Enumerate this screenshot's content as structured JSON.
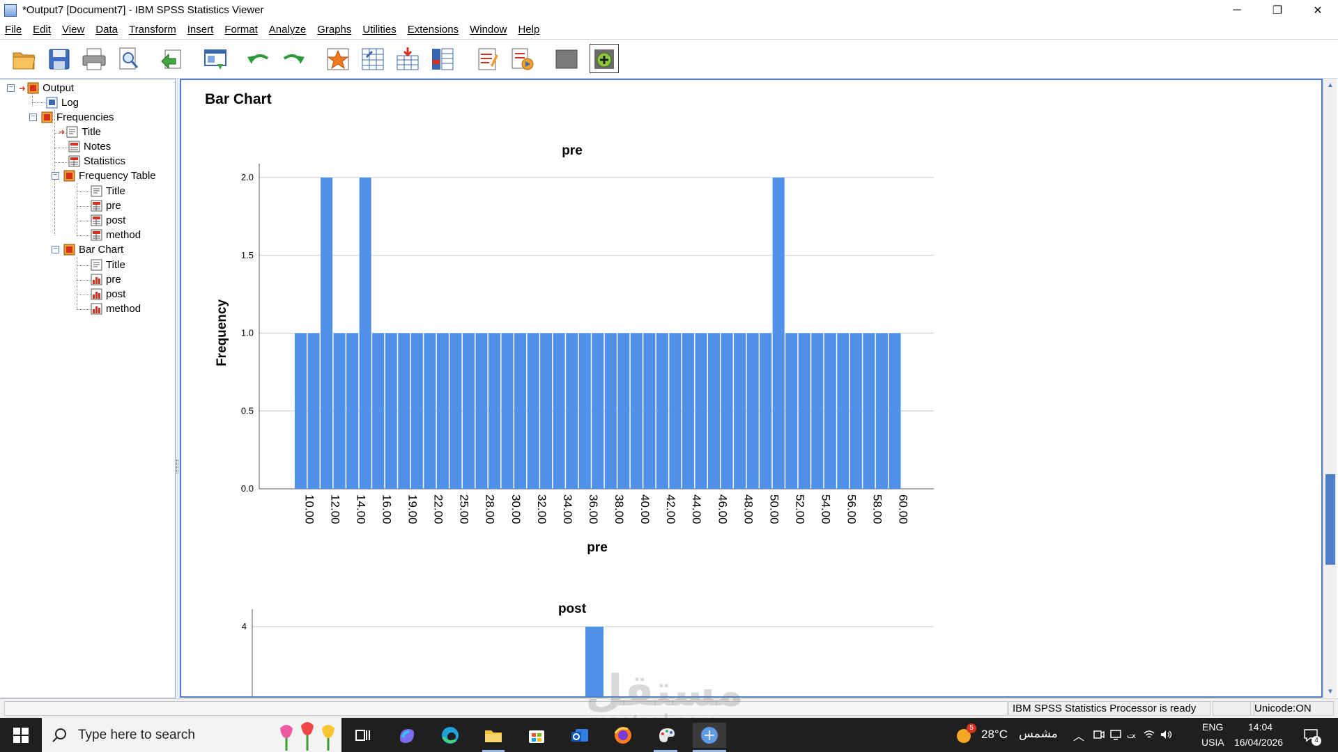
{
  "window": {
    "title": "*Output7 [Document7] - IBM SPSS Statistics Viewer",
    "minimize_glyph": "─",
    "restore_glyph": "❐",
    "close_glyph": "✕"
  },
  "menu": [
    "File",
    "Edit",
    "View",
    "Data",
    "Transform",
    "Insert",
    "Format",
    "Analyze",
    "Graphs",
    "Utilities",
    "Extensions",
    "Window",
    "Help"
  ],
  "toolbar": {
    "icons": [
      "open-folder-icon",
      "save-icon",
      "print-icon",
      "print-preview-icon",
      "export-icon",
      "recall-dialog-icon",
      "undo-icon",
      "redo-icon",
      "goto-data-icon",
      "goto-case-icon",
      "goto-variable-icon",
      "variables-icon",
      "designate-window-icon",
      "create-script-icon",
      "blank-icon",
      "add-icon"
    ]
  },
  "outline": {
    "root": "Output",
    "log": "Log",
    "frequencies": "Frequencies",
    "freq_title": "Title",
    "notes": "Notes",
    "statistics": "Statistics",
    "frequency_table": "Frequency Table",
    "ft_title": "Title",
    "ft_pre": "pre",
    "ft_post": "post",
    "ft_method": "method",
    "bar_chart": "Bar Chart",
    "bc_title": "Title",
    "bc_pre": "pre",
    "bc_post": "post",
    "bc_method": "method"
  },
  "content": {
    "section_heading": "Bar Chart"
  },
  "chart_data": [
    {
      "type": "bar",
      "title": "pre",
      "xlabel": "pre",
      "ylabel": "Frequency",
      "ylim": [
        0,
        2.0
      ],
      "yticks": [
        "0.0",
        "0.5",
        "1.0",
        "1.5",
        "2.0"
      ],
      "grid": true,
      "categories": [
        "10.00",
        "11.00",
        "12.00",
        "13.00",
        "14.00",
        "15.00",
        "16.00",
        "17.00",
        "19.00",
        "20.00",
        "22.00",
        "23.00",
        "25.00",
        "26.00",
        "28.00",
        "29.00",
        "30.00",
        "31.00",
        "32.00",
        "33.00",
        "34.00",
        "35.00",
        "36.00",
        "37.00",
        "38.00",
        "39.00",
        "40.00",
        "41.00",
        "42.00",
        "43.00",
        "44.00",
        "45.00",
        "46.00",
        "47.00",
        "48.00",
        "49.00",
        "50.00",
        "51.00",
        "52.00",
        "53.00",
        "54.00",
        "55.00",
        "56.00",
        "57.00",
        "58.00",
        "59.00",
        "60.00"
      ],
      "xtick_labels_shown": [
        "10.00",
        "12.00",
        "14.00",
        "16.00",
        "19.00",
        "22.00",
        "25.00",
        "28.00",
        "30.00",
        "32.00",
        "34.00",
        "36.00",
        "38.00",
        "40.00",
        "42.00",
        "44.00",
        "46.00",
        "48.00",
        "50.00",
        "52.00",
        "54.00",
        "56.00",
        "58.00",
        "60.00"
      ],
      "values": [
        1,
        1,
        2,
        1,
        1,
        2,
        1,
        1,
        1,
        1,
        1,
        1,
        1,
        1,
        1,
        1,
        1,
        1,
        1,
        1,
        1,
        1,
        1,
        1,
        1,
        1,
        1,
        1,
        1,
        1,
        1,
        1,
        1,
        1,
        1,
        1,
        1,
        2,
        1,
        1,
        1,
        1,
        1,
        1,
        1,
        1,
        1
      ],
      "bar_color": "#4f90e8"
    },
    {
      "type": "bar",
      "title": "post",
      "yticks": [
        "4"
      ],
      "grid": true,
      "partial": true,
      "bar_color": "#4f90e8"
    }
  ],
  "statusbar": {
    "message": "IBM SPSS Statistics Processor is ready",
    "unicode": "Unicode:ON"
  },
  "taskbar": {
    "search_placeholder": "Type here to search",
    "weather_temp": "28°C",
    "weather_desc": "مشمس",
    "weather_badge": "5",
    "lang": "ENG",
    "region": "USIA",
    "time": "14:04",
    "date": "16/04/2026",
    "notification_count": "4"
  },
  "watermark": {
    "text": "مستقل",
    "sub": "mostaql.com"
  }
}
